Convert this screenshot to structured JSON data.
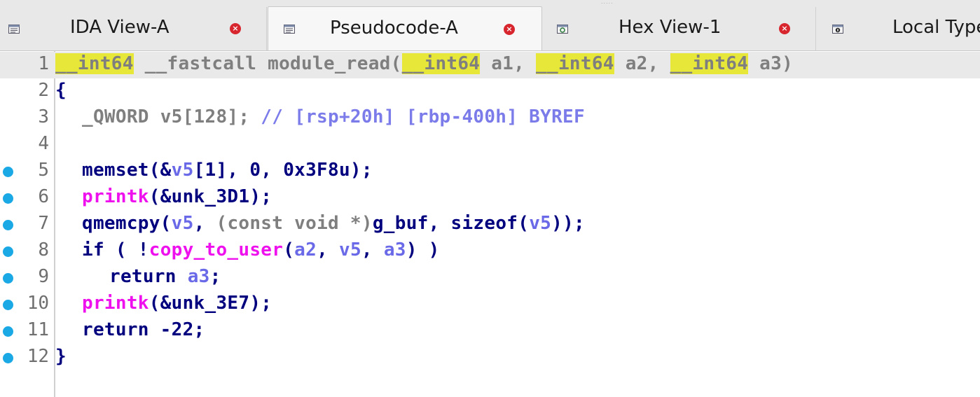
{
  "tabs": [
    {
      "label": "IDA View-A",
      "icon": "disassembly-view-icon",
      "close": "×",
      "active": false
    },
    {
      "label": "Pseudocode-A",
      "icon": "pseudocode-view-icon",
      "close": "×",
      "active": true
    },
    {
      "label": "Hex View-1",
      "icon": "hex-view-icon",
      "close": "×",
      "active": false
    },
    {
      "label": "Local Types",
      "icon": "local-types-icon",
      "close": "",
      "active": false
    }
  ],
  "lines": [
    {
      "n": "1",
      "bp": false,
      "t": {
        "a": "__int64",
        "b": " __fastcall module_read(",
        "c": "__int64",
        "d": " a1, ",
        "e": "__int64",
        "f": " a2, ",
        "g": "__int64",
        "h": " a3)"
      }
    },
    {
      "n": "2",
      "bp": false,
      "t": {
        "a": "{"
      }
    },
    {
      "n": "3",
      "bp": false,
      "t": {
        "a": "_QWORD",
        "b": " v5[128]; ",
        "c": "// [rsp+20h] [rbp-400h] BYREF"
      }
    },
    {
      "n": "4",
      "bp": false,
      "t": {}
    },
    {
      "n": "5",
      "bp": true,
      "t": {
        "a": "memset(&",
        "b": "v5",
        "c": "[1], 0, 0x3F8u);"
      }
    },
    {
      "n": "6",
      "bp": true,
      "t": {
        "a": "printk",
        "b": "(&unk_3D1);"
      }
    },
    {
      "n": "7",
      "bp": true,
      "t": {
        "a": "qmemcpy(",
        "b": "v5",
        "c": ", ",
        "d": "(const void *)",
        "e": "g_buf, sizeof(",
        "f": "v5",
        "g": "));"
      }
    },
    {
      "n": "8",
      "bp": true,
      "t": {
        "a": "if ( !",
        "b": "copy_to_user",
        "c": "(",
        "d": "a2",
        "e": ", ",
        "f": "v5",
        "g": ", ",
        "h": "a3",
        "i": ") )"
      }
    },
    {
      "n": "9",
      "bp": true,
      "t": {
        "a": "return ",
        "b": "a3",
        "c": ";"
      }
    },
    {
      "n": "10",
      "bp": true,
      "t": {
        "a": "printk",
        "b": "(&unk_3E7);"
      }
    },
    {
      "n": "11",
      "bp": true,
      "t": {
        "a": "return -22;"
      }
    },
    {
      "n": "12",
      "bp": true,
      "t": {
        "a": "}"
      }
    }
  ],
  "colors": {
    "keyword": "#00007f",
    "type_highlight": "#e7e73a",
    "variable": "#6a6ae8",
    "comment": "#7b7bea",
    "import_function": "#ee11ee",
    "breakpoint": "#1ba9e6",
    "close_button": "#d8262f"
  }
}
